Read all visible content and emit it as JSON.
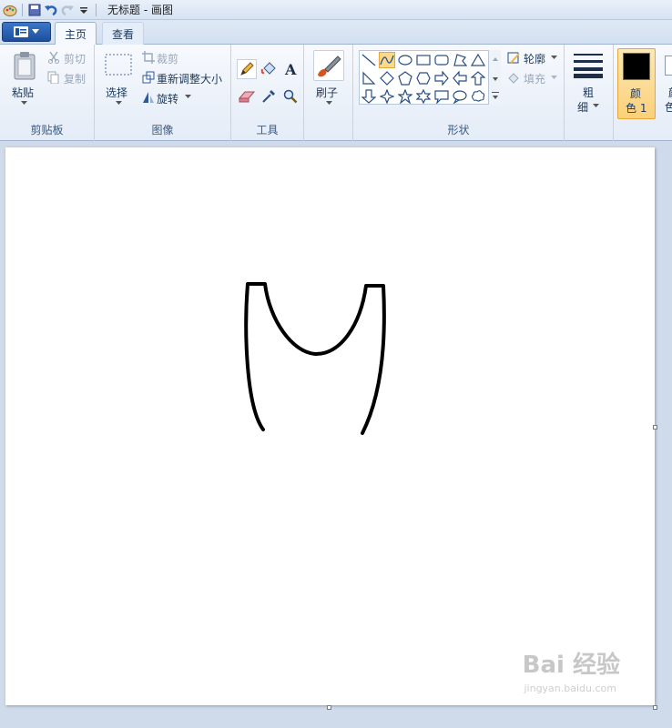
{
  "window": {
    "title": "无标题 - 画图"
  },
  "tabs": {
    "home": "主页",
    "view": "查看"
  },
  "clipboard": {
    "paste": "粘贴",
    "cut": "剪切",
    "copy": "复制",
    "group": "剪贴板"
  },
  "image": {
    "select": "选择",
    "crop": "裁剪",
    "resize": "重新调整大小",
    "rotate": "旋转",
    "group": "图像"
  },
  "tools": {
    "group": "工具"
  },
  "brushes": {
    "label": "刷子"
  },
  "shapes": {
    "outline": "轮廓",
    "fill": "填充",
    "group": "形状"
  },
  "size": {
    "line1": "粗",
    "line2": "细"
  },
  "colors": {
    "color1_line1": "颜",
    "color1_line2": "色 1",
    "color2_line1": "颜",
    "color2_line2": "色",
    "color1": "#000000",
    "color2": "#ffffff"
  },
  "watermark": {
    "main": "Bai 经验",
    "sub": "jingyan.baidu.com"
  }
}
